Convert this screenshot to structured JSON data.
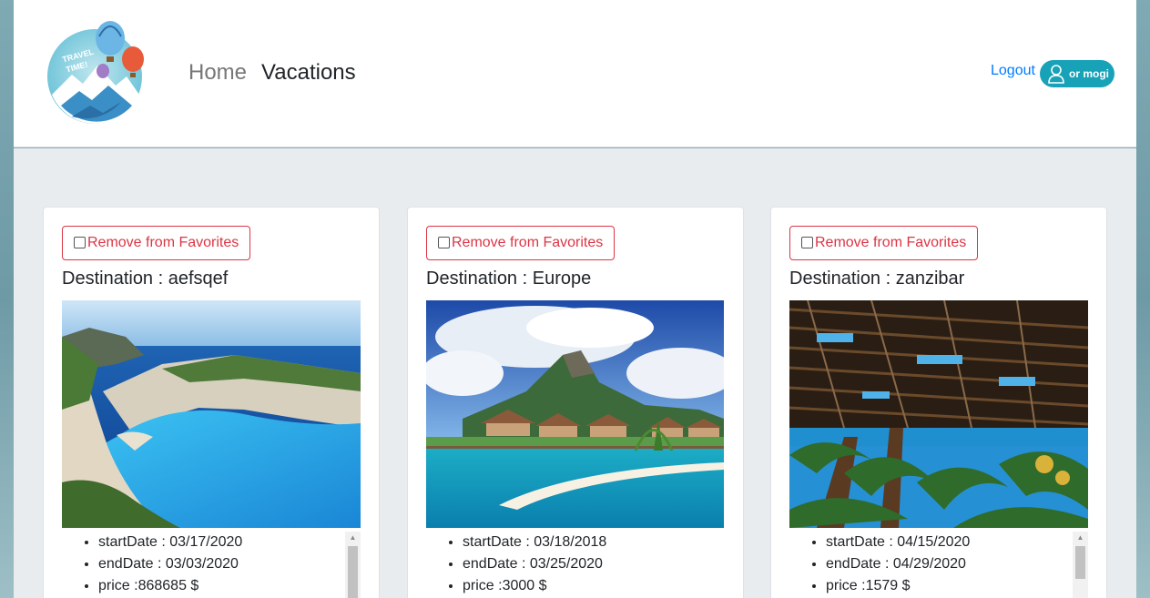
{
  "nav": {
    "logo_text": "TRAVEL TIME!",
    "links": [
      "Home",
      "Vacations"
    ],
    "logout_label": "Logout",
    "user_label": "or mogi"
  },
  "cards": [
    {
      "button_label": "Remove from Favorites",
      "destination": "Destination : aefsqef",
      "details": [
        "startDate : 03/17/2020",
        "endDate : 03/03/2020",
        "price :868685 $"
      ]
    },
    {
      "button_label": "Remove from Favorites",
      "destination": "Destination : Europe",
      "details": [
        "startDate : 03/18/2018",
        "endDate : 03/25/2020",
        "price :3000 $"
      ]
    },
    {
      "button_label": "Remove from Favorites",
      "destination": "Destination : zanzibar",
      "details": [
        "startDate : 04/15/2020",
        "endDate : 04/29/2020",
        "price :1579 $"
      ]
    }
  ],
  "colors": {
    "accent": "#007bff",
    "danger": "#dc3545",
    "badge": "#17a2b8"
  }
}
